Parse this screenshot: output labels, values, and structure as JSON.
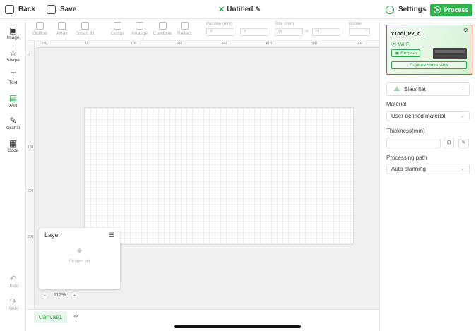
{
  "topbar": {
    "back_label": "Back",
    "save_label": "Save",
    "title": "Untitled",
    "settings_label": "Settings",
    "process_label": "Process"
  },
  "left_tools": [
    {
      "label": "Image",
      "icon": "image-icon"
    },
    {
      "label": "Shape",
      "icon": "shape-icon"
    },
    {
      "label": "Text",
      "icon": "text-icon"
    },
    {
      "label": "xArt",
      "icon": "xart-icon"
    },
    {
      "label": "Graffiti",
      "icon": "graffiti-icon"
    },
    {
      "label": "Code",
      "icon": "code-icon"
    }
  ],
  "history": {
    "undo": "Undo",
    "redo": "Redo"
  },
  "subtoolbar": {
    "outline": "Outline",
    "array": "Array",
    "smart_fill": "Smart fill",
    "group": "Group",
    "arrange": "Arrange",
    "combine": "Combine",
    "reflect": "Reflect",
    "position_label": "Position (mm)",
    "pos_x": "X",
    "pos_y": "Y",
    "size_label": "Size (mm)",
    "size_w": "W",
    "size_h": "H",
    "rotate_label": "Rotate",
    "rotate_value": "°"
  },
  "ruler": {
    "h_ticks": [
      "-100",
      "0",
      "100",
      "200",
      "300",
      "400",
      "500",
      "600"
    ],
    "v_ticks": [
      "0",
      "100",
      "200",
      "300"
    ]
  },
  "layer_panel": {
    "title": "Layer",
    "empty_text": "No layer yet"
  },
  "zoom": {
    "minus": "−",
    "value": "112%",
    "plus": "+"
  },
  "tabs": {
    "canvas": "Canvas1",
    "add": "+"
  },
  "device": {
    "name": "xTool_P2_d...",
    "connection": "Wi-Fi",
    "refresh_label": "Refresh",
    "capture_label": "Capture close view"
  },
  "right_panel": {
    "platform": "Slats flat",
    "material_label": "Material",
    "material_value": "User-defined material",
    "thickness_label": "Thickness(mm)",
    "thickness_value": "",
    "path_label": "Processing path",
    "path_value": "Auto planning"
  },
  "colors": {
    "accent": "#30b34e",
    "highlight": "#e0453a"
  }
}
